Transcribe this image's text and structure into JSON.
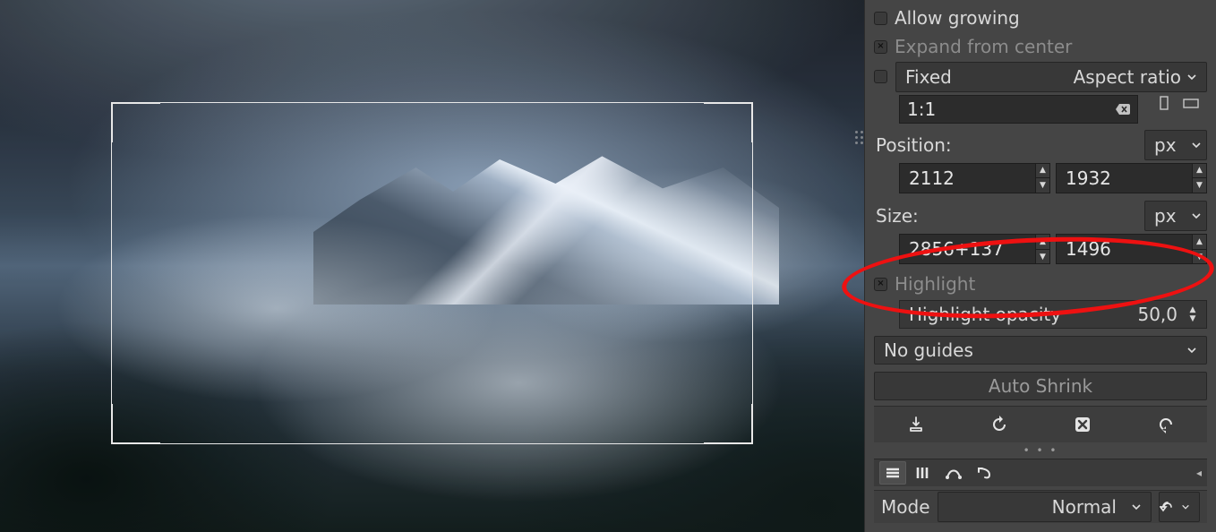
{
  "tool_options": {
    "allow_growing": {
      "label": "Allow growing",
      "checked": false
    },
    "expand_from_center": {
      "label": "Expand from center",
      "checked": true
    },
    "fixed": {
      "label": "Fixed",
      "checked": false,
      "mode_label": "Aspect ratio",
      "value": "1:1"
    },
    "position": {
      "label": "Position:",
      "unit": "px",
      "x": "2112",
      "y": "1932"
    },
    "size": {
      "label": "Size:",
      "unit": "px",
      "w": "2856+137",
      "h": "1496"
    },
    "highlight": {
      "label": "Highlight",
      "checked": true,
      "opacity_label": "Highlight opacity",
      "opacity_value": "50,0"
    },
    "guides": {
      "label": "No guides"
    },
    "auto_shrink": {
      "label": "Auto Shrink"
    }
  },
  "mode_bar": {
    "label": "Mode",
    "value": "Normal"
  }
}
